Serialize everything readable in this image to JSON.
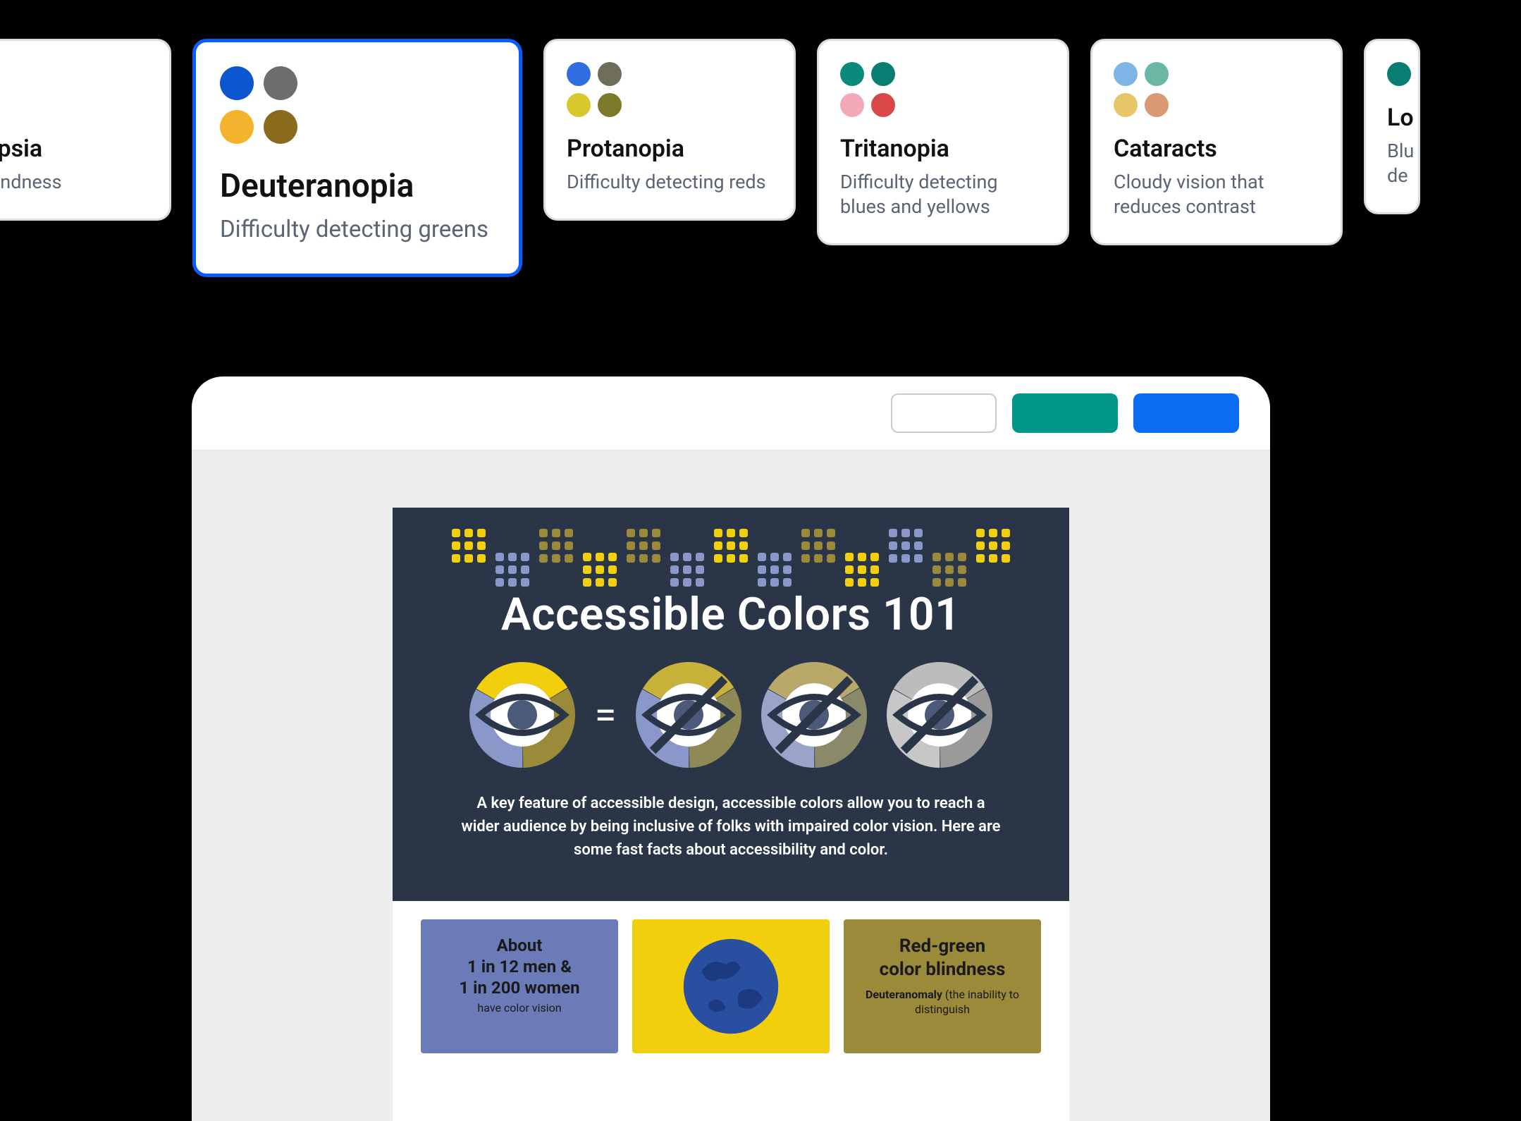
{
  "filters": [
    {
      "id": "achromatopsia",
      "title": "Achromatopsia",
      "desc_visible": "omplete color ndness",
      "swatches": [
        "#5f5f5f",
        "#7d7d7d",
        "#6a6a6a",
        "#8a8a8a"
      ]
    },
    {
      "id": "deuteranopia",
      "title": "Deuteranopia",
      "desc": "Difficulty detecting greens",
      "selected": true,
      "swatches": [
        "#0b57d0",
        "#6d6d6d",
        "#f2b42c",
        "#8a6b1e"
      ]
    },
    {
      "id": "protanopia",
      "title": "Protanopia",
      "desc": "Difficulty detecting reds",
      "swatches": [
        "#2f6de0",
        "#6e6e5b",
        "#d8c82e",
        "#7a7a2a"
      ]
    },
    {
      "id": "tritanopia",
      "title": "Tritanopia",
      "desc": "Difficulty detecting blues and yellows",
      "swatches": [
        "#0a8a7a",
        "#0a7d72",
        "#f2a9b9",
        "#d94848"
      ]
    },
    {
      "id": "cataracts",
      "title": "Cataracts",
      "desc": "Cloudy vision that reduces contrast",
      "swatches": [
        "#7fb4e6",
        "#6bb7a4",
        "#e7c66a",
        "#d99a73"
      ]
    },
    {
      "id": "lowvision",
      "title_visible": "Lo",
      "desc_visible": "Blu de",
      "swatches": [
        "#0a7d72",
        "",
        "",
        ""
      ]
    }
  ],
  "toolbar": {
    "buttons": [
      "outline",
      "teal",
      "blue"
    ],
    "colors": {
      "teal": "#009688",
      "blue": "#0b6cf2"
    }
  },
  "infographic": {
    "title": "Accessible Colors 101",
    "intro": "A key feature of accessible design, accessible colors allow you to reach a wider audience by being inclusive of folks with impaired color vision. Here are some fast facts about accessibility and color.",
    "banner_colors": {
      "yellow": "#f2cf0d",
      "blue": "#8a97c9",
      "olive": "#9a8a3a"
    },
    "rings": [
      {
        "seg": [
          "#f2cf0d",
          "#9a8a3a",
          "#8a97c9"
        ],
        "eye": "open"
      },
      {
        "seg": [
          "#c9b23a",
          "#8f8a55",
          "#8a97c9"
        ],
        "eye": "slash"
      },
      {
        "seg": [
          "#b8a86a",
          "#8a8a6a",
          "#9aa4c9"
        ],
        "eye": "slash"
      },
      {
        "seg": [
          "#bcbcbc",
          "#9a9a9a",
          "#c7c7c7"
        ],
        "eye": "slash"
      }
    ],
    "tiles": {
      "stat": {
        "line1": "About",
        "line2": "1 in 12 men &",
        "line3": "1 in 200 women",
        "sub": "have color vision"
      },
      "globe": {
        "color": "#2a4ea0"
      },
      "redgreen": {
        "h1": "Red-green",
        "h2": "color blindness",
        "body_prefix": "Deuteranomaly",
        "body_rest": " (the inability to distinguish"
      }
    }
  }
}
